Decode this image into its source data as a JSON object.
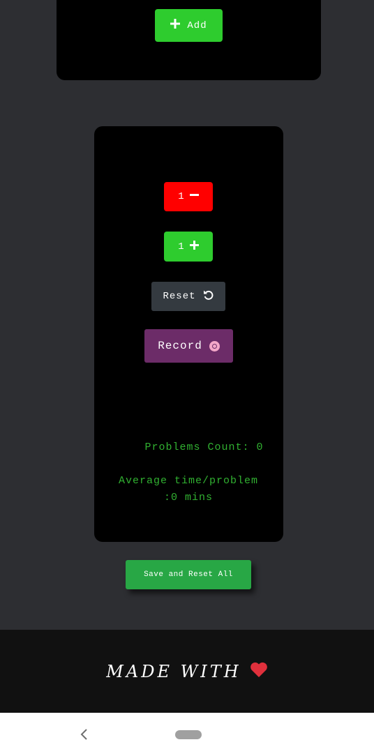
{
  "top_card": {
    "add_label": "Add",
    "add_icon": "plus-icon"
  },
  "counter": {
    "decrement_value": "1",
    "decrement_icon": "minus-icon",
    "increment_value": "1",
    "increment_icon": "plus-icon",
    "reset_label": "Reset",
    "reset_icon": "undo-icon",
    "record_label": "Record",
    "record_icon": "record-icon",
    "problems_count": "Problems Count: 0",
    "avg_time_line1": "Average time/problem",
    "avg_time_line2": ":0 mins"
  },
  "save_reset_label": "Save and Reset All",
  "footer": {
    "text": "MADE WITH",
    "icon": "heart-icon"
  },
  "nav": {
    "back_icon": "back-icon",
    "home_icon": "home-pill-icon"
  },
  "colors": {
    "background": "#2d2e32",
    "card": "#000000",
    "add_green": "#2ecc2e",
    "decrement_red": "#ff0000",
    "reset_dark": "#343a40",
    "record_purple": "#6c2c68",
    "stat_green": "#31b131",
    "save_green": "#28a745",
    "footer_bg": "#111111",
    "heart_red": "#e0303c"
  }
}
